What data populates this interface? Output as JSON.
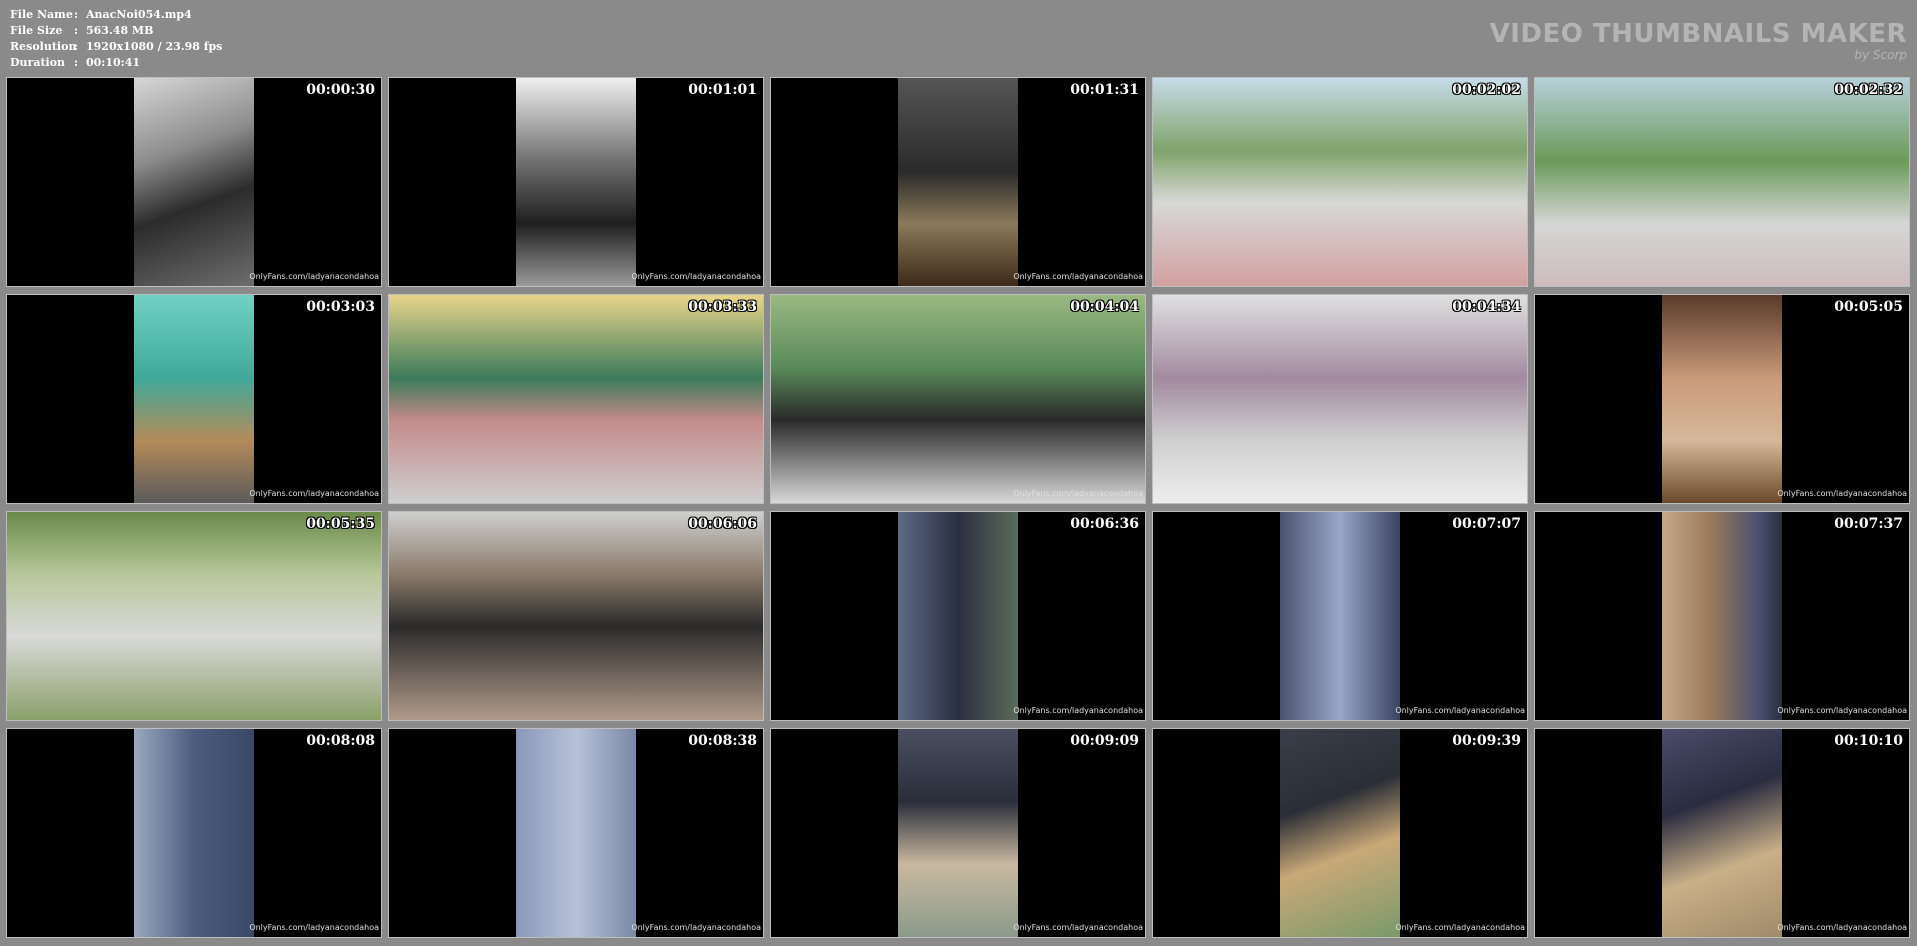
{
  "info": {
    "file_name_label": "File Name",
    "file_name_value": "AnacNoi054.mp4",
    "file_size_label": "File Size",
    "file_size_value": "563.48 MB",
    "resolution_label": "Resolution",
    "resolution_value": "1920x1080 / 23.98 fps",
    "duration_label": "Duration",
    "duration_value": "00:10:41",
    "separator": ":"
  },
  "brand": {
    "title": "VIDEO THUMBNAILS MAKER",
    "by": "by Scorp"
  },
  "thumbnails": [
    {
      "time": "00:00:30",
      "watermark": "OnlyFans.com/ladyanacondahoa"
    },
    {
      "time": "00:01:01",
      "watermark": "OnlyFans.com/ladyanacondahoa"
    },
    {
      "time": "00:01:31",
      "watermark": "OnlyFans.com/ladyanacondahoa"
    },
    {
      "time": "00:02:02",
      "watermark": ""
    },
    {
      "time": "00:02:32",
      "watermark": ""
    },
    {
      "time": "00:03:03",
      "watermark": "OnlyFans.com/ladyanacondahoa"
    },
    {
      "time": "00:03:33",
      "watermark": ""
    },
    {
      "time": "00:04:04",
      "watermark": "OnlyFans.com/ladyanacondahoa"
    },
    {
      "time": "00:04:34",
      "watermark": ""
    },
    {
      "time": "00:05:05",
      "watermark": "OnlyFans.com/ladyanacondahoa"
    },
    {
      "time": "00:05:35",
      "watermark": ""
    },
    {
      "time": "00:06:06",
      "watermark": ""
    },
    {
      "time": "00:06:36",
      "watermark": "OnlyFans.com/ladyanacondahoa"
    },
    {
      "time": "00:07:07",
      "watermark": "OnlyFans.com/ladyanacondahoa"
    },
    {
      "time": "00:07:37",
      "watermark": "OnlyFans.com/ladyanacondahoa"
    },
    {
      "time": "00:08:08",
      "watermark": "OnlyFans.com/ladyanacondahoa"
    },
    {
      "time": "00:08:38",
      "watermark": "OnlyFans.com/ladyanacondahoa"
    },
    {
      "time": "00:09:09",
      "watermark": "OnlyFans.com/ladyanacondahoa"
    },
    {
      "time": "00:09:39",
      "watermark": "OnlyFans.com/ladyanacondahoa"
    },
    {
      "time": "00:10:10",
      "watermark": "OnlyFans.com/ladyanacondahoa"
    }
  ]
}
